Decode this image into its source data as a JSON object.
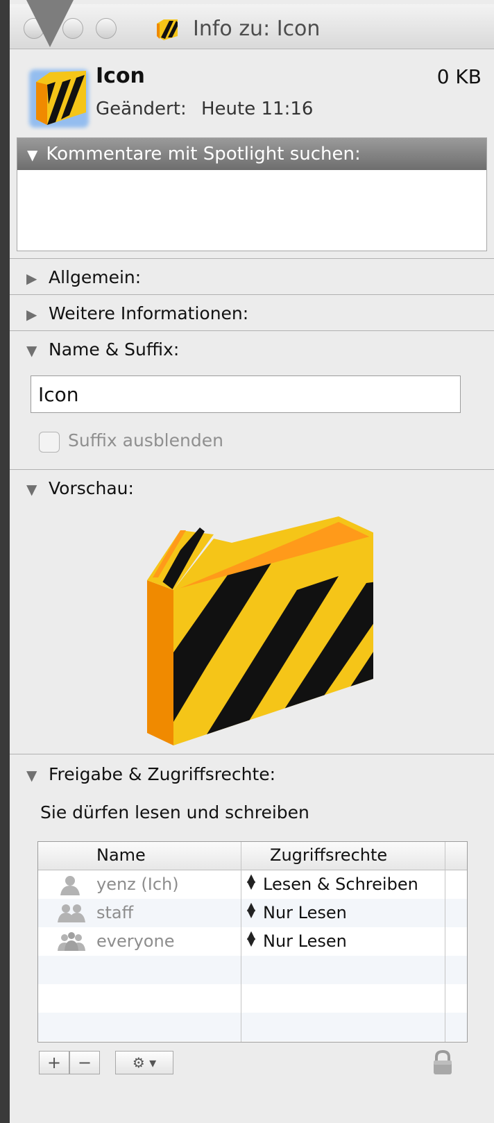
{
  "window": {
    "title": "Info zu: Icon"
  },
  "header": {
    "file_name": "Icon",
    "file_size": "0 KB",
    "modified_label": "Geändert:",
    "modified_value": "Heute 11:16"
  },
  "comments": {
    "label": "Kommentare mit Spotlight suchen:",
    "value": ""
  },
  "sections": {
    "general": "Allgemein:",
    "more_info": "Weitere Informationen:",
    "name_suffix": "Name & Suffix:",
    "preview": "Vorschau:",
    "sharing": "Freigabe & Zugriffsrechte:"
  },
  "name_suffix": {
    "name_value": "Icon",
    "hide_suffix_label": "Suffix ausblenden",
    "hide_suffix_checked": false
  },
  "sharing": {
    "summary": "Sie dürfen lesen und schreiben",
    "columns": [
      "Name",
      "Zugriffsrechte"
    ],
    "rows": [
      {
        "name": "yenz (Ich)",
        "privilege": "Lesen & Schreiben",
        "icon": "single-user-icon"
      },
      {
        "name": "staff",
        "privilege": "Nur Lesen",
        "icon": "group-icon"
      },
      {
        "name": "everyone",
        "privilege": "Nur Lesen",
        "icon": "everyone-icon"
      }
    ]
  },
  "toolbar": {
    "add_label": "+",
    "remove_label": "−",
    "gear_label": "⚙ ▾"
  },
  "colors": {
    "stripe_yellow": "#f5c518",
    "stripe_black": "#111111",
    "folder_orange": "#f08a00"
  }
}
